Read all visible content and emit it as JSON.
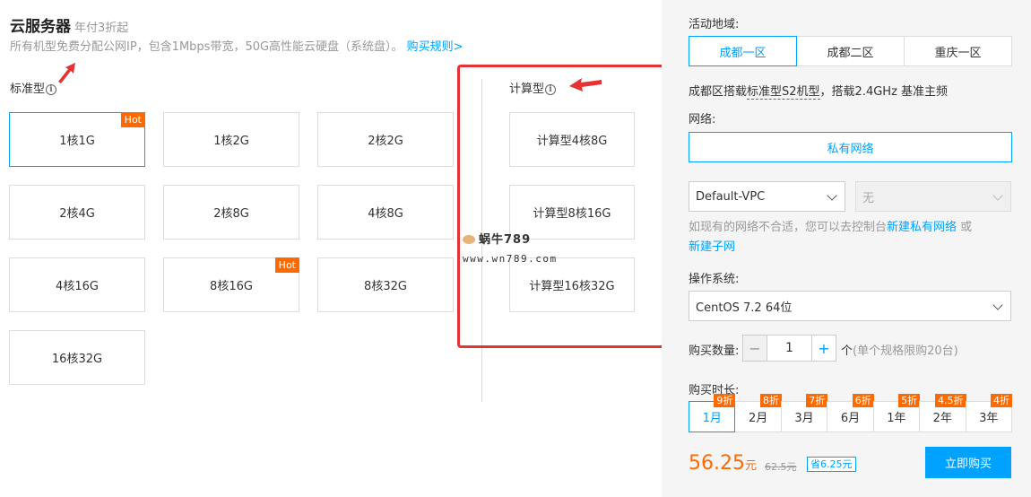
{
  "header": {
    "title": "云服务器",
    "title_sub": "年付3折起",
    "desc": "所有机型免费分配公网IP，包含1Mbps带宽，50G高性能云硬盘（系统盘）。",
    "rules_link": "购买规则>"
  },
  "standard": {
    "label": "标准型",
    "specs": [
      "1核1G",
      "1核2G",
      "2核2G",
      "2核4G",
      "2核8G",
      "4核8G",
      "4核16G",
      "8核16G",
      "8核32G",
      "16核32G"
    ],
    "hot_badge": "Hot",
    "selected": "1核1G"
  },
  "compute": {
    "label": "计算型",
    "specs": [
      "计算型4核8G",
      "计算型8核16G",
      "计算型16核32G"
    ]
  },
  "info_glyph": "i",
  "watermark": {
    "title": "蜗牛789",
    "url": "www.wn789.com"
  },
  "panel": {
    "region_label": "活动地域:",
    "regions": [
      "成都一区",
      "成都二区",
      "重庆一区"
    ],
    "region_note_prefix": "成都区搭载",
    "region_note_model": "标准型S2机型",
    "region_note_suffix": "，搭载2.4GHz 基准主频",
    "network_label": "网络:",
    "network_button": "私有网络",
    "vpc_select": "Default-VPC",
    "subnet_select": "无",
    "hint_prefix": "如现有的网络不合适，您可以去控制台",
    "hint_link1": "新建私有网络",
    "hint_or": "或",
    "hint_link2": "新建子网",
    "os_label": "操作系统:",
    "os_select": "CentOS 7.2 64位",
    "qty_label": "购买数量:",
    "qty_minus": "−",
    "qty_value": "1",
    "qty_plus": "+",
    "qty_unit": "个",
    "qty_limit": "(单个规格限购20台)",
    "duration_label": "购买时长:",
    "durations": [
      {
        "label": "1月",
        "discount": "9折"
      },
      {
        "label": "2月",
        "discount": "8折"
      },
      {
        "label": "3月",
        "discount": "7折"
      },
      {
        "label": "6月",
        "discount": "6折"
      },
      {
        "label": "1年",
        "discount": "5折"
      },
      {
        "label": "2年",
        "discount": "4.5折"
      },
      {
        "label": "3年",
        "discount": "4折"
      }
    ],
    "price": "56.25",
    "price_unit": "元",
    "original_price": "62.5元",
    "saving": "省6.25元",
    "buy_button": "立即购买"
  },
  "colors": {
    "accent": "#00a2ff",
    "hot": "#ff6a00",
    "annotation": "#e53333"
  }
}
